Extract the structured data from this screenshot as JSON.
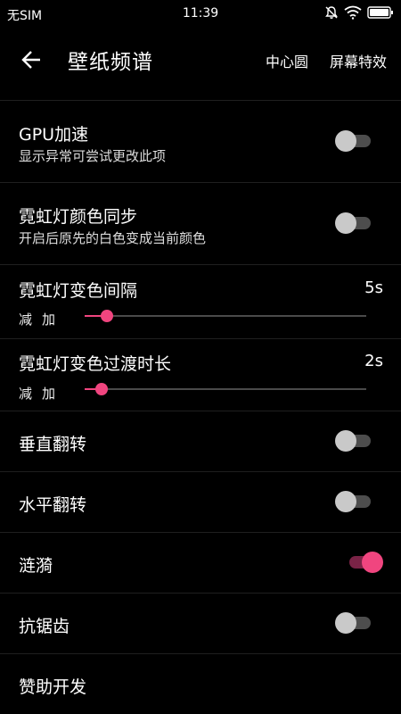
{
  "status_bar": {
    "carrier": "无SIM",
    "time": "11:39",
    "icons": [
      "mute-icon",
      "wifi-icon",
      "battery-icon"
    ]
  },
  "app_bar": {
    "title": "壁纸频谱",
    "actions": [
      "中心圆",
      "屏幕特效"
    ]
  },
  "settings": {
    "gpu": {
      "label": "GPU加速",
      "sub": "显示异常可尝试更改此项",
      "enabled": false
    },
    "neon_sync": {
      "label": "霓虹灯颜色同步",
      "sub": "开启后原先的白色变成当前颜色",
      "enabled": false
    },
    "neon_interval": {
      "label": "霓虹灯变色间隔",
      "value": "5s",
      "minus": "减",
      "plus": "加",
      "level": 0.08
    },
    "neon_transition": {
      "label": "霓虹灯变色过渡时长",
      "value": "2s",
      "minus": "减",
      "plus": "加",
      "level": 0.06
    },
    "vertical_flip": {
      "label": "垂直翻转",
      "enabled": false
    },
    "horizontal_flip": {
      "label": "水平翻转",
      "enabled": false
    },
    "ripple": {
      "label": "涟漪",
      "enabled": true
    },
    "antialias": {
      "label": "抗锯齿",
      "enabled": false
    },
    "sponsor": {
      "label": "赞助开发"
    }
  },
  "colors": {
    "accent": "#f0457f",
    "background": "#000000"
  }
}
